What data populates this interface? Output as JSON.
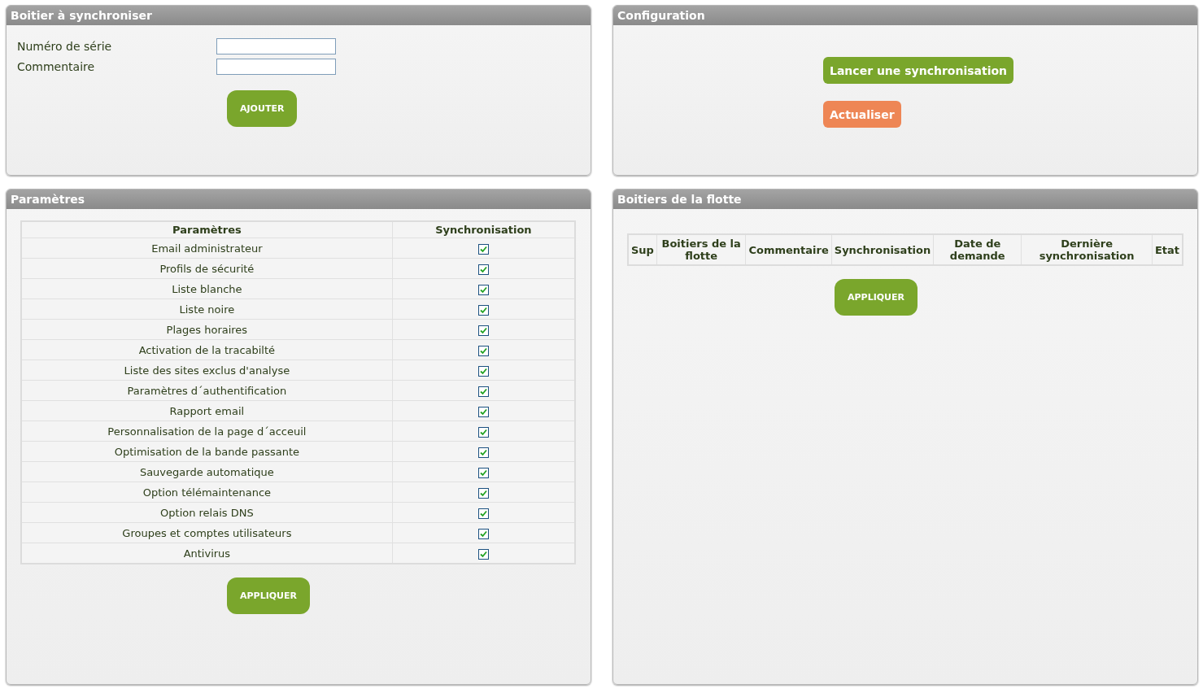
{
  "boitier_panel": {
    "title": "Boitier à synchroniser",
    "fields": [
      {
        "label": "Numéro de série"
      },
      {
        "label": "Commentaire"
      }
    ],
    "button": "AJOUTER"
  },
  "configuration_panel": {
    "title": "Configuration",
    "buttons": [
      {
        "label": "Lancer une synchronisation",
        "kind": "primary"
      },
      {
        "label": "Actualiser",
        "kind": "warning"
      }
    ]
  },
  "parametres_panel": {
    "title": "Paramètres",
    "columns": [
      "Paramètres",
      "Synchronisation"
    ],
    "rows": [
      {
        "name": "Email administrateur",
        "checked": true
      },
      {
        "name": "Profils de sécurité",
        "checked": true
      },
      {
        "name": "Liste blanche",
        "checked": true
      },
      {
        "name": "Liste noire",
        "checked": true
      },
      {
        "name": "Plages horaires",
        "checked": true
      },
      {
        "name": "Activation de la tracabilté",
        "checked": true
      },
      {
        "name": "Liste des sites exclus d'analyse",
        "checked": true
      },
      {
        "name": "Paramètres d´authentification",
        "checked": true
      },
      {
        "name": "Rapport email",
        "checked": true
      },
      {
        "name": "Personnalisation de la page d´acceuil",
        "checked": true
      },
      {
        "name": "Optimisation de la bande passante",
        "checked": true
      },
      {
        "name": "Sauvegarde automatique",
        "checked": true
      },
      {
        "name": "Option télémaintenance",
        "checked": true
      },
      {
        "name": "Option relais DNS",
        "checked": true
      },
      {
        "name": "Groupes et comptes utilisateurs",
        "checked": true
      },
      {
        "name": "Antivirus",
        "checked": true
      }
    ],
    "button": "APPLIQUER"
  },
  "flotte_panel": {
    "title": "Boitiers de la flotte",
    "columns": [
      "Sup",
      "Boitiers de la flotte",
      "Commentaire",
      "Synchronisation",
      "Date de demande",
      "Dernière synchronisation",
      "Etat"
    ],
    "button": "APPLIQUER"
  }
}
